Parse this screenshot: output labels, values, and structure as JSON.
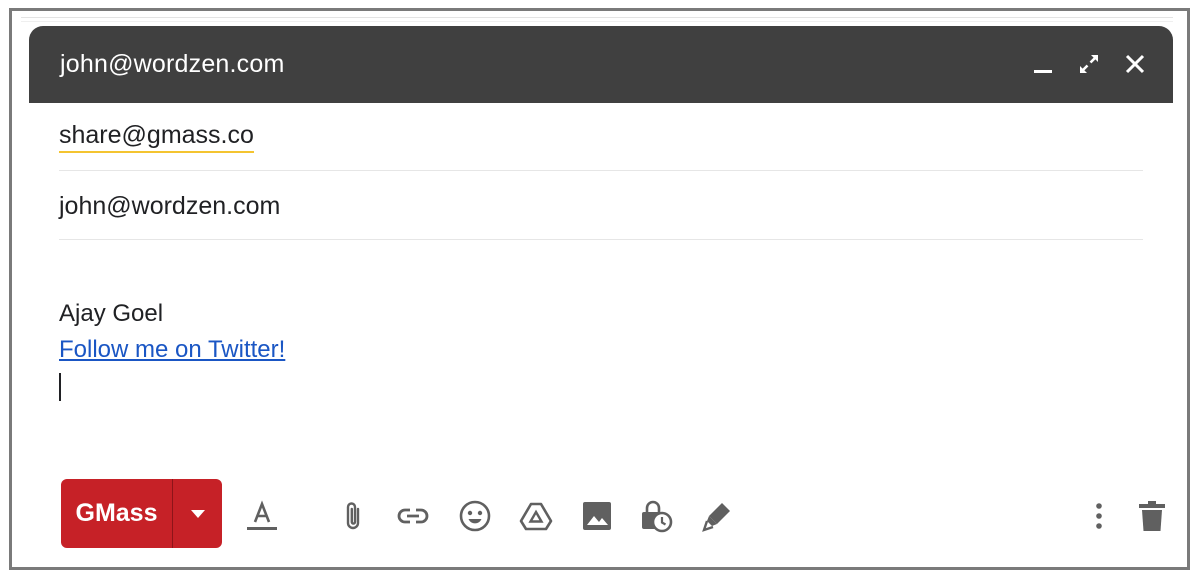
{
  "window": {
    "title": "john@wordzen.com"
  },
  "fields": {
    "to": "share@gmass.co",
    "subject": "john@wordzen.com"
  },
  "body": {
    "signature_name": "Ajay Goel",
    "signature_link": "Follow me on Twitter!"
  },
  "toolbar": {
    "send_label": "GMass",
    "icons": [
      "format-text-icon",
      "attach-icon",
      "link-icon",
      "emoji-icon",
      "drive-icon",
      "photo-icon",
      "confidential-mode-icon",
      "signature-icon",
      "more-options-icon",
      "discard-icon"
    ]
  },
  "colors": {
    "titlebar": "#404040",
    "send_button": "#c62127",
    "link": "#1a56c4",
    "icon": "#606060",
    "to_underline": "#f4c430"
  }
}
